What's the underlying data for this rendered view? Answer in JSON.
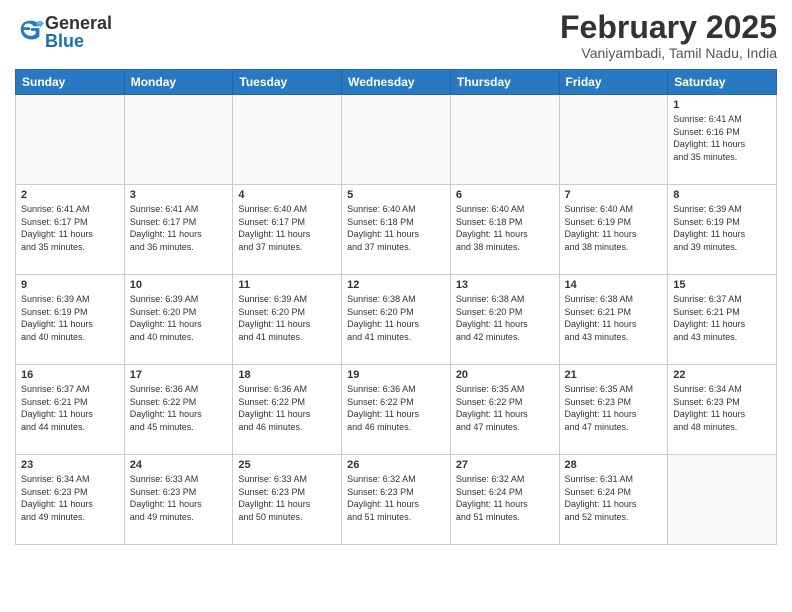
{
  "header": {
    "logo_general": "General",
    "logo_blue": "Blue",
    "month_title": "February 2025",
    "subtitle": "Vaniyambadi, Tamil Nadu, India"
  },
  "days_of_week": [
    "Sunday",
    "Monday",
    "Tuesday",
    "Wednesday",
    "Thursday",
    "Friday",
    "Saturday"
  ],
  "weeks": [
    [
      {
        "day": "",
        "info": ""
      },
      {
        "day": "",
        "info": ""
      },
      {
        "day": "",
        "info": ""
      },
      {
        "day": "",
        "info": ""
      },
      {
        "day": "",
        "info": ""
      },
      {
        "day": "",
        "info": ""
      },
      {
        "day": "1",
        "info": "Sunrise: 6:41 AM\nSunset: 6:16 PM\nDaylight: 11 hours\nand 35 minutes."
      }
    ],
    [
      {
        "day": "2",
        "info": "Sunrise: 6:41 AM\nSunset: 6:17 PM\nDaylight: 11 hours\nand 35 minutes."
      },
      {
        "day": "3",
        "info": "Sunrise: 6:41 AM\nSunset: 6:17 PM\nDaylight: 11 hours\nand 36 minutes."
      },
      {
        "day": "4",
        "info": "Sunrise: 6:40 AM\nSunset: 6:17 PM\nDaylight: 11 hours\nand 37 minutes."
      },
      {
        "day": "5",
        "info": "Sunrise: 6:40 AM\nSunset: 6:18 PM\nDaylight: 11 hours\nand 37 minutes."
      },
      {
        "day": "6",
        "info": "Sunrise: 6:40 AM\nSunset: 6:18 PM\nDaylight: 11 hours\nand 38 minutes."
      },
      {
        "day": "7",
        "info": "Sunrise: 6:40 AM\nSunset: 6:19 PM\nDaylight: 11 hours\nand 38 minutes."
      },
      {
        "day": "8",
        "info": "Sunrise: 6:39 AM\nSunset: 6:19 PM\nDaylight: 11 hours\nand 39 minutes."
      }
    ],
    [
      {
        "day": "9",
        "info": "Sunrise: 6:39 AM\nSunset: 6:19 PM\nDaylight: 11 hours\nand 40 minutes."
      },
      {
        "day": "10",
        "info": "Sunrise: 6:39 AM\nSunset: 6:20 PM\nDaylight: 11 hours\nand 40 minutes."
      },
      {
        "day": "11",
        "info": "Sunrise: 6:39 AM\nSunset: 6:20 PM\nDaylight: 11 hours\nand 41 minutes."
      },
      {
        "day": "12",
        "info": "Sunrise: 6:38 AM\nSunset: 6:20 PM\nDaylight: 11 hours\nand 41 minutes."
      },
      {
        "day": "13",
        "info": "Sunrise: 6:38 AM\nSunset: 6:20 PM\nDaylight: 11 hours\nand 42 minutes."
      },
      {
        "day": "14",
        "info": "Sunrise: 6:38 AM\nSunset: 6:21 PM\nDaylight: 11 hours\nand 43 minutes."
      },
      {
        "day": "15",
        "info": "Sunrise: 6:37 AM\nSunset: 6:21 PM\nDaylight: 11 hours\nand 43 minutes."
      }
    ],
    [
      {
        "day": "16",
        "info": "Sunrise: 6:37 AM\nSunset: 6:21 PM\nDaylight: 11 hours\nand 44 minutes."
      },
      {
        "day": "17",
        "info": "Sunrise: 6:36 AM\nSunset: 6:22 PM\nDaylight: 11 hours\nand 45 minutes."
      },
      {
        "day": "18",
        "info": "Sunrise: 6:36 AM\nSunset: 6:22 PM\nDaylight: 11 hours\nand 46 minutes."
      },
      {
        "day": "19",
        "info": "Sunrise: 6:36 AM\nSunset: 6:22 PM\nDaylight: 11 hours\nand 46 minutes."
      },
      {
        "day": "20",
        "info": "Sunrise: 6:35 AM\nSunset: 6:22 PM\nDaylight: 11 hours\nand 47 minutes."
      },
      {
        "day": "21",
        "info": "Sunrise: 6:35 AM\nSunset: 6:23 PM\nDaylight: 11 hours\nand 47 minutes."
      },
      {
        "day": "22",
        "info": "Sunrise: 6:34 AM\nSunset: 6:23 PM\nDaylight: 11 hours\nand 48 minutes."
      }
    ],
    [
      {
        "day": "23",
        "info": "Sunrise: 6:34 AM\nSunset: 6:23 PM\nDaylight: 11 hours\nand 49 minutes."
      },
      {
        "day": "24",
        "info": "Sunrise: 6:33 AM\nSunset: 6:23 PM\nDaylight: 11 hours\nand 49 minutes."
      },
      {
        "day": "25",
        "info": "Sunrise: 6:33 AM\nSunset: 6:23 PM\nDaylight: 11 hours\nand 50 minutes."
      },
      {
        "day": "26",
        "info": "Sunrise: 6:32 AM\nSunset: 6:23 PM\nDaylight: 11 hours\nand 51 minutes."
      },
      {
        "day": "27",
        "info": "Sunrise: 6:32 AM\nSunset: 6:24 PM\nDaylight: 11 hours\nand 51 minutes."
      },
      {
        "day": "28",
        "info": "Sunrise: 6:31 AM\nSunset: 6:24 PM\nDaylight: 11 hours\nand 52 minutes."
      },
      {
        "day": "",
        "info": ""
      }
    ]
  ]
}
